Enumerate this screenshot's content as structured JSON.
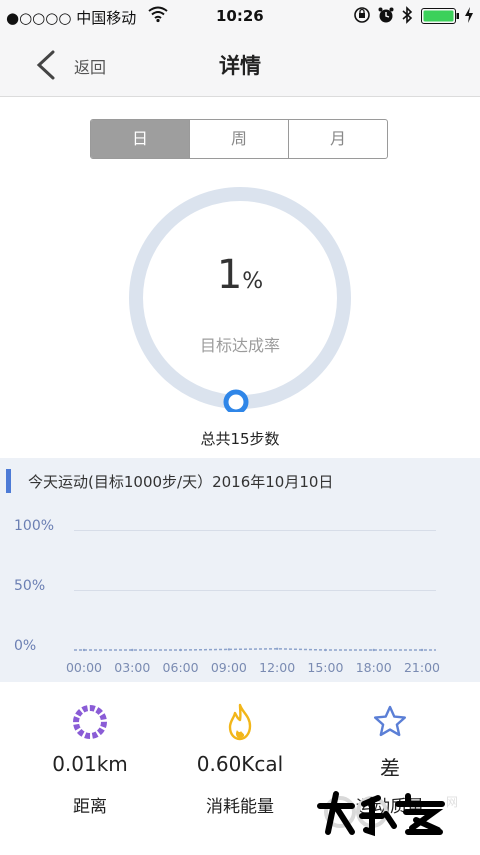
{
  "status_bar": {
    "carrier": "●○○○○ 中国移动",
    "wifi_icon": "wifi-icon",
    "time": "10:26"
  },
  "nav": {
    "back_label": "返回",
    "title": "详情"
  },
  "tabs": [
    {
      "label": "日",
      "active": true
    },
    {
      "label": "周",
      "active": false
    },
    {
      "label": "月",
      "active": false
    }
  ],
  "progress": {
    "value": "1",
    "unit": "%",
    "label": "目标达成率",
    "fraction": 0.01
  },
  "total_steps": "总共15步数",
  "chart_header": "今天运动(目标1000步/天）2016年10月10日",
  "chart_data": {
    "type": "line",
    "title": "",
    "xlabel": "",
    "ylabel": "",
    "x": [
      "00:00",
      "03:00",
      "06:00",
      "09:00",
      "12:00",
      "15:00",
      "18:00",
      "21:00"
    ],
    "y_ticks": [
      "100%",
      "50%",
      "0%"
    ],
    "ylim": [
      0,
      100
    ],
    "series": [
      {
        "values": [
          0,
          0,
          0,
          0.5,
          1,
          0,
          0,
          0
        ]
      }
    ],
    "grid": true
  },
  "stats": [
    {
      "icon": "distance-ring-icon",
      "value": "0.01km",
      "label": "距离"
    },
    {
      "icon": "flame-icon",
      "value": "0.60Kcal",
      "label": "消耗能量"
    },
    {
      "icon": "star-icon",
      "value": "差",
      "label": "运动质量"
    }
  ],
  "colors": {
    "accent": "#4d7bd6",
    "ring": "#dbe3ee",
    "tab_active": "#9e9e9e",
    "distance": "#8a5cd6",
    "energy": "#f2b619",
    "quality": "#5b7fd6"
  }
}
